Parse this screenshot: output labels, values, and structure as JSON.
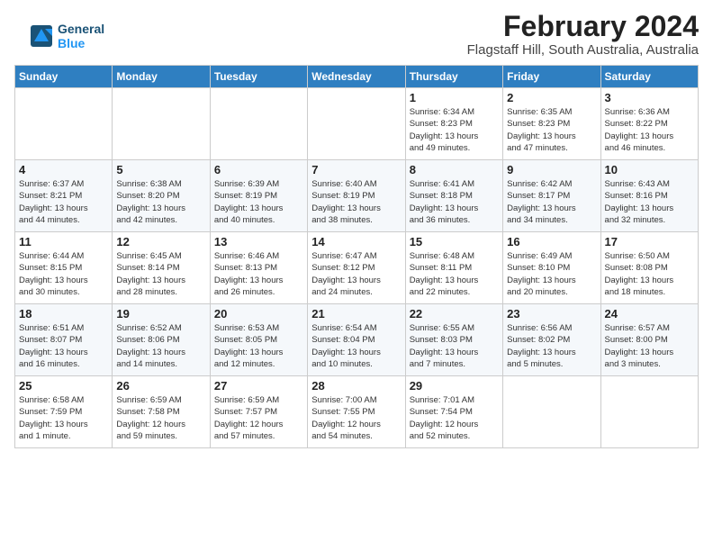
{
  "header": {
    "month_year": "February 2024",
    "location": "Flagstaff Hill, South Australia, Australia",
    "logo_line1": "General",
    "logo_line2": "Blue"
  },
  "days_of_week": [
    "Sunday",
    "Monday",
    "Tuesday",
    "Wednesday",
    "Thursday",
    "Friday",
    "Saturday"
  ],
  "weeks": [
    [
      {
        "day": "",
        "info": ""
      },
      {
        "day": "",
        "info": ""
      },
      {
        "day": "",
        "info": ""
      },
      {
        "day": "",
        "info": ""
      },
      {
        "day": "1",
        "info": "Sunrise: 6:34 AM\nSunset: 8:23 PM\nDaylight: 13 hours\nand 49 minutes."
      },
      {
        "day": "2",
        "info": "Sunrise: 6:35 AM\nSunset: 8:23 PM\nDaylight: 13 hours\nand 47 minutes."
      },
      {
        "day": "3",
        "info": "Sunrise: 6:36 AM\nSunset: 8:22 PM\nDaylight: 13 hours\nand 46 minutes."
      }
    ],
    [
      {
        "day": "4",
        "info": "Sunrise: 6:37 AM\nSunset: 8:21 PM\nDaylight: 13 hours\nand 44 minutes."
      },
      {
        "day": "5",
        "info": "Sunrise: 6:38 AM\nSunset: 8:20 PM\nDaylight: 13 hours\nand 42 minutes."
      },
      {
        "day": "6",
        "info": "Sunrise: 6:39 AM\nSunset: 8:19 PM\nDaylight: 13 hours\nand 40 minutes."
      },
      {
        "day": "7",
        "info": "Sunrise: 6:40 AM\nSunset: 8:19 PM\nDaylight: 13 hours\nand 38 minutes."
      },
      {
        "day": "8",
        "info": "Sunrise: 6:41 AM\nSunset: 8:18 PM\nDaylight: 13 hours\nand 36 minutes."
      },
      {
        "day": "9",
        "info": "Sunrise: 6:42 AM\nSunset: 8:17 PM\nDaylight: 13 hours\nand 34 minutes."
      },
      {
        "day": "10",
        "info": "Sunrise: 6:43 AM\nSunset: 8:16 PM\nDaylight: 13 hours\nand 32 minutes."
      }
    ],
    [
      {
        "day": "11",
        "info": "Sunrise: 6:44 AM\nSunset: 8:15 PM\nDaylight: 13 hours\nand 30 minutes."
      },
      {
        "day": "12",
        "info": "Sunrise: 6:45 AM\nSunset: 8:14 PM\nDaylight: 13 hours\nand 28 minutes."
      },
      {
        "day": "13",
        "info": "Sunrise: 6:46 AM\nSunset: 8:13 PM\nDaylight: 13 hours\nand 26 minutes."
      },
      {
        "day": "14",
        "info": "Sunrise: 6:47 AM\nSunset: 8:12 PM\nDaylight: 13 hours\nand 24 minutes."
      },
      {
        "day": "15",
        "info": "Sunrise: 6:48 AM\nSunset: 8:11 PM\nDaylight: 13 hours\nand 22 minutes."
      },
      {
        "day": "16",
        "info": "Sunrise: 6:49 AM\nSunset: 8:10 PM\nDaylight: 13 hours\nand 20 minutes."
      },
      {
        "day": "17",
        "info": "Sunrise: 6:50 AM\nSunset: 8:08 PM\nDaylight: 13 hours\nand 18 minutes."
      }
    ],
    [
      {
        "day": "18",
        "info": "Sunrise: 6:51 AM\nSunset: 8:07 PM\nDaylight: 13 hours\nand 16 minutes."
      },
      {
        "day": "19",
        "info": "Sunrise: 6:52 AM\nSunset: 8:06 PM\nDaylight: 13 hours\nand 14 minutes."
      },
      {
        "day": "20",
        "info": "Sunrise: 6:53 AM\nSunset: 8:05 PM\nDaylight: 13 hours\nand 12 minutes."
      },
      {
        "day": "21",
        "info": "Sunrise: 6:54 AM\nSunset: 8:04 PM\nDaylight: 13 hours\nand 10 minutes."
      },
      {
        "day": "22",
        "info": "Sunrise: 6:55 AM\nSunset: 8:03 PM\nDaylight: 13 hours\nand 7 minutes."
      },
      {
        "day": "23",
        "info": "Sunrise: 6:56 AM\nSunset: 8:02 PM\nDaylight: 13 hours\nand 5 minutes."
      },
      {
        "day": "24",
        "info": "Sunrise: 6:57 AM\nSunset: 8:00 PM\nDaylight: 13 hours\nand 3 minutes."
      }
    ],
    [
      {
        "day": "25",
        "info": "Sunrise: 6:58 AM\nSunset: 7:59 PM\nDaylight: 13 hours\nand 1 minute."
      },
      {
        "day": "26",
        "info": "Sunrise: 6:59 AM\nSunset: 7:58 PM\nDaylight: 12 hours\nand 59 minutes."
      },
      {
        "day": "27",
        "info": "Sunrise: 6:59 AM\nSunset: 7:57 PM\nDaylight: 12 hours\nand 57 minutes."
      },
      {
        "day": "28",
        "info": "Sunrise: 7:00 AM\nSunset: 7:55 PM\nDaylight: 12 hours\nand 54 minutes."
      },
      {
        "day": "29",
        "info": "Sunrise: 7:01 AM\nSunset: 7:54 PM\nDaylight: 12 hours\nand 52 minutes."
      },
      {
        "day": "",
        "info": ""
      },
      {
        "day": "",
        "info": ""
      }
    ]
  ]
}
